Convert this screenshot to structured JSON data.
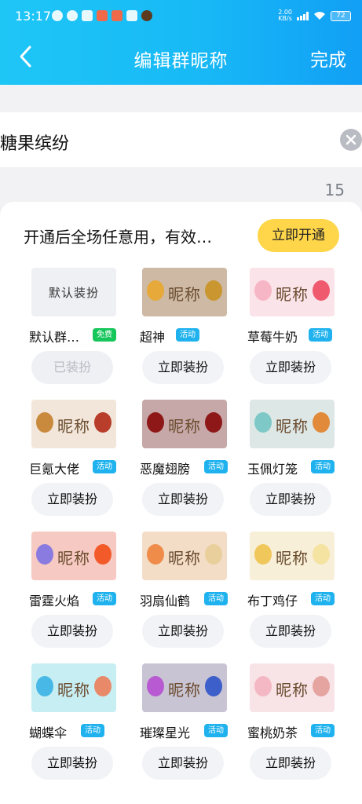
{
  "status": {
    "time": "13:17",
    "speed": "2.00\nKB/s",
    "battery": "72"
  },
  "header": {
    "title": "编辑群昵称",
    "done_label": "完成"
  },
  "input": {
    "value": "糖果缤纷",
    "counter": "15"
  },
  "promo": {
    "text": "开通后全场任意用，有效…",
    "button_label": "立即开通"
  },
  "items": [
    {
      "preview": "默认装扮",
      "name": "默认群…",
      "tag": "免费",
      "tag_type": "free",
      "button": "已装扮",
      "bg": "#eef0f4",
      "orn": [
        "",
        ""
      ]
    },
    {
      "preview": "昵称",
      "name": "超神",
      "tag": "活动",
      "tag_type": "act",
      "button": "立即装扮",
      "bg": "#cdb9a4",
      "orn": [
        "#e6a93a",
        "#c9962f"
      ]
    },
    {
      "preview": "昵称",
      "name": "草莓牛奶",
      "tag": "活动",
      "tag_type": "act",
      "button": "立即装扮",
      "bg": "#fbe3ea",
      "orn": [
        "#f7b6c6",
        "#ef5a6e"
      ]
    },
    {
      "preview": "昵称",
      "name": "巨氪大佬",
      "tag": "活动",
      "tag_type": "act",
      "button": "立即装扮",
      "bg": "#f1e6d9",
      "orn": [
        "#c98a3d",
        "#b83d2a"
      ]
    },
    {
      "preview": "昵称",
      "name": "恶魔翅膀",
      "tag": "活动",
      "tag_type": "act",
      "button": "立即装扮",
      "bg": "#c7a8a8",
      "orn": [
        "#8e1717",
        "#8e1717"
      ]
    },
    {
      "preview": "昵称",
      "name": "玉佩灯笼",
      "tag": "活动",
      "tag_type": "act",
      "button": "立即装扮",
      "bg": "#dde7e6",
      "orn": [
        "#7ec9c7",
        "#e08a3a"
      ]
    },
    {
      "preview": "昵称",
      "name": "雷霆火焰",
      "tag": "活动",
      "tag_type": "act",
      "button": "立即装扮",
      "bg": "#f6c9c2",
      "orn": [
        "#8a7be0",
        "#f35a2a"
      ]
    },
    {
      "preview": "昵称",
      "name": "羽扇仙鹤",
      "tag": "活动",
      "tag_type": "act",
      "button": "立即装扮",
      "bg": "#f3ddc7",
      "orn": [
        "#ef8c4a",
        "#e8cf9c"
      ]
    },
    {
      "preview": "昵称",
      "name": "布丁鸡仔",
      "tag": "活动",
      "tag_type": "act",
      "button": "立即装扮",
      "bg": "#f7efd8",
      "orn": [
        "#f0c75b",
        "#f5e3a2"
      ]
    },
    {
      "preview": "昵称",
      "name": "蝴蝶伞",
      "tag": "活动",
      "tag_type": "act",
      "button": "立即装扮",
      "bg": "#c6eef3",
      "orn": [
        "#48b8e6",
        "#e88a6a"
      ]
    },
    {
      "preview": "昵称",
      "name": "璀璨星光",
      "tag": "活动",
      "tag_type": "act",
      "button": "立即装扮",
      "bg": "#c9c4d4",
      "orn": [
        "#b85ad1",
        "#3c5fc9"
      ]
    },
    {
      "preview": "昵称",
      "name": "蜜桃奶茶",
      "tag": "活动",
      "tag_type": "act",
      "button": "立即装扮",
      "bg": "#f8e3e7",
      "orn": [
        "#f3b8c4",
        "#e6a4a0"
      ]
    }
  ],
  "colors": {
    "header": "#18b9f6",
    "accent": "#ffd64a",
    "tag_free": "#15c65a",
    "tag_act": "#1fb2ee"
  }
}
